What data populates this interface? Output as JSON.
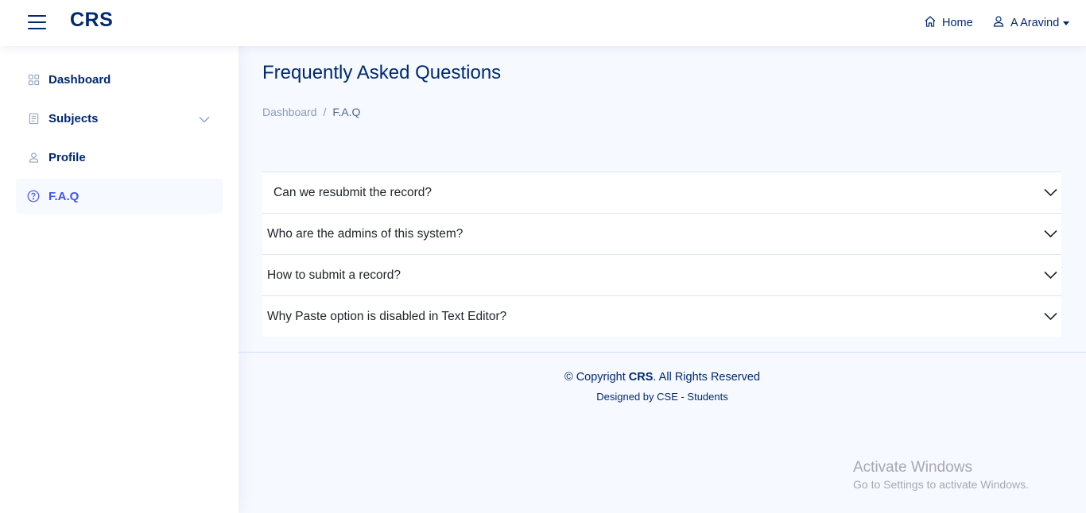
{
  "header": {
    "brand": "CRS",
    "home_label": "Home",
    "user_label": "A Aravind"
  },
  "sidebar": {
    "items": [
      {
        "label": "Dashboard",
        "icon": "grid-icon"
      },
      {
        "label": "Subjects",
        "icon": "journal-icon",
        "expandable": true
      },
      {
        "label": "Profile",
        "icon": "person-icon"
      },
      {
        "label": "F.A.Q",
        "icon": "question-circle-icon",
        "active": true
      }
    ]
  },
  "main": {
    "title": "Frequently Asked Questions",
    "breadcrumb": {
      "link": "Dashboard",
      "separator": "/",
      "current": "F.A.Q"
    },
    "faqs": [
      "Can we resubmit the record?",
      "Who are the admins of this system?",
      "How to submit a record?",
      "Why Paste option is disabled in Text Editor?"
    ]
  },
  "footer": {
    "copyright_prefix": "© Copyright ",
    "copyright_brand": "CRS",
    "copyright_suffix": ". All Rights Reserved",
    "designed": "Designed by CSE - Students"
  },
  "watermark": {
    "title": "Activate Windows",
    "subtitle": "Go to Settings to activate Windows."
  },
  "colors": {
    "primary": "#012970",
    "accent": "#4154f1",
    "background": "#f6f9ff",
    "muted": "#899bbd"
  }
}
